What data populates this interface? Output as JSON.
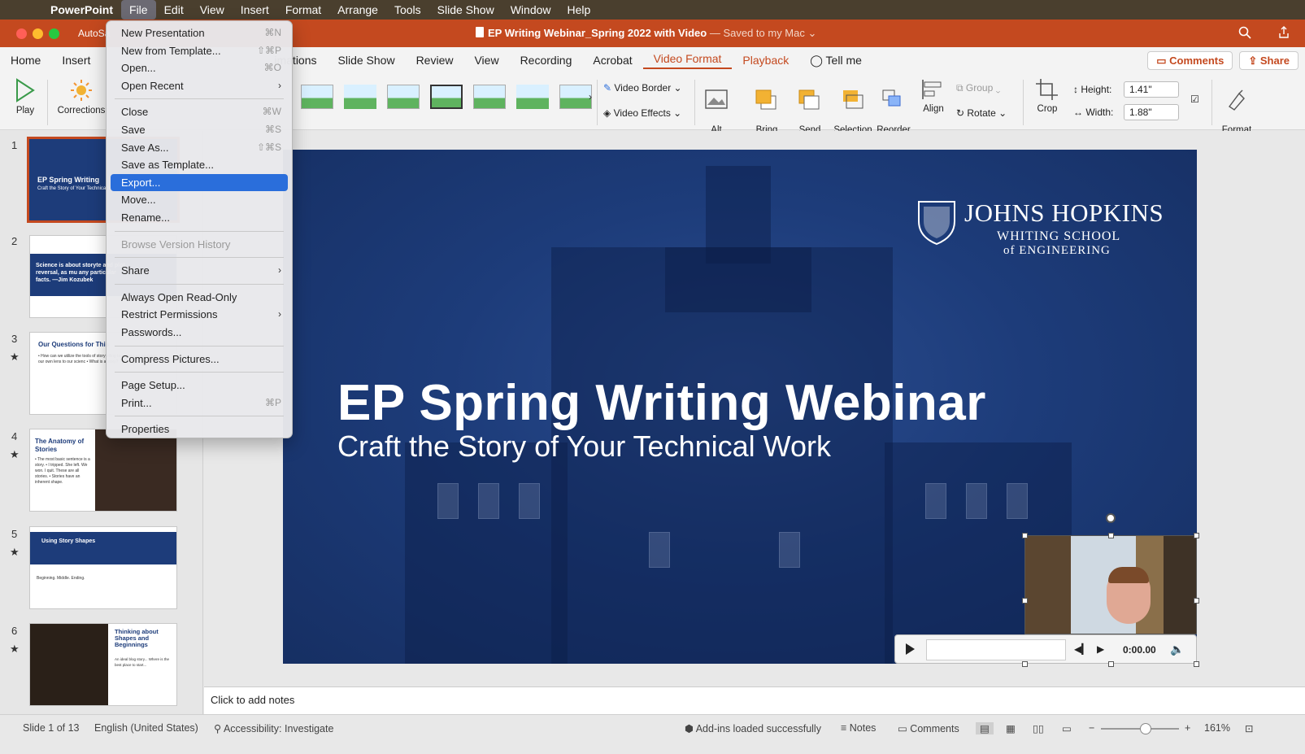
{
  "menubar": {
    "app": "PowerPoint",
    "items": [
      "File",
      "Edit",
      "View",
      "Insert",
      "Format",
      "Arrange",
      "Tools",
      "Slide Show",
      "Window",
      "Help"
    ]
  },
  "titlebar": {
    "autosave": "AutoSa",
    "title": "EP Writing Webinar_Spring 2022 with Video",
    "saved": " — Saved to my Mac ⌄"
  },
  "tabs": {
    "items": [
      "Home",
      "Insert",
      "imations",
      "Slide Show",
      "Review",
      "View",
      "Recording",
      "Acrobat",
      "Video Format",
      "Playback",
      "Tell me"
    ],
    "comments": "Comments",
    "share": "Share"
  },
  "ribbon": {
    "play": "Play",
    "corrections": "Corrections",
    "video_border": "Video Border",
    "video_effects": "Video Effects",
    "alt_text": "Alt\nText",
    "bring_forward": "Bring\nForward",
    "send_backward": "Send\nBackward",
    "selection_pane": "Selection\nPane",
    "reorder_objects": "Reorder\nObjects",
    "align": "Align",
    "group": "Group",
    "rotate": "Rotate",
    "crop": "Crop",
    "height_label": "Height:",
    "height_value": "1.41\"",
    "width_label": "Width:",
    "width_value": "1.88\"",
    "format_pane": "Format\nPane"
  },
  "file_menu": {
    "items": [
      {
        "label": "New Presentation",
        "shortcut": "⌘N"
      },
      {
        "label": "New from Template...",
        "shortcut": "⇧⌘P"
      },
      {
        "label": "Open...",
        "shortcut": "⌘O"
      },
      {
        "label": "Open Recent",
        "submenu": "›"
      },
      {
        "label": "Close",
        "shortcut": "⌘W"
      },
      {
        "label": "Save",
        "shortcut": "⌘S"
      },
      {
        "label": "Save As...",
        "shortcut": "⇧⌘S"
      },
      {
        "label": "Save as Template..."
      },
      {
        "label": "Export..."
      },
      {
        "label": "Move..."
      },
      {
        "label": "Rename..."
      },
      {
        "label": "Browse Version History"
      },
      {
        "label": "Share",
        "submenu": "›"
      },
      {
        "label": "Always Open Read-Only"
      },
      {
        "label": "Restrict Permissions",
        "submenu": "›"
      },
      {
        "label": "Passwords..."
      },
      {
        "label": "Compress Pictures..."
      },
      {
        "label": "Page Setup..."
      },
      {
        "label": "Print...",
        "shortcut": "⌘P"
      },
      {
        "label": "Properties"
      }
    ]
  },
  "thumbnails": [
    {
      "num": "1",
      "title": "EP Spring Writing",
      "text": "Craft the Story of Your Technical W"
    },
    {
      "num": "2",
      "text": "Science is about storyte and plot reversal, as mu any particular facts. —Jim Kozubek"
    },
    {
      "num": "3",
      "title": "Our Questions for This",
      "text": "• How can we utilize the tools of storytelling to • How can we bring our own lens to our scienc • What is a story?"
    },
    {
      "num": "4",
      "title": "The Anatomy of Stories",
      "text": "• The most basic sentence is a story. • I tripped. She left. We won. I quit. These are all stories. • Stories have an inherent shape."
    },
    {
      "num": "5",
      "title": "Using Story Shapes",
      "text": "Beginning. Middle. Ending."
    },
    {
      "num": "6",
      "title": "Thinking about Shapes and Beginnings",
      "text": "An ideal blog story... Where is the best place to start..."
    }
  ],
  "slide": {
    "logo_line1": "JOHNS HOPKINS",
    "logo_line2": "WHITING SCHOOL",
    "logo_line3": "of ENGINEERING",
    "title": "EP Spring Writing Webinar",
    "subtitle": "Craft the Story of Your Technical Work",
    "video_time": "0:00.00"
  },
  "notes": "Click to add notes",
  "status": {
    "slide": "Slide 1 of 13",
    "language": "English (United States)",
    "accessibility": "Accessibility: Investigate",
    "addins": "Add-ins loaded successfully",
    "notes": "Notes",
    "comments": "Comments",
    "zoom": "161%"
  },
  "colors": {
    "accent": "#c4491f",
    "slide_blue": "#1d3c7a",
    "highlight": "#2a6edb"
  }
}
